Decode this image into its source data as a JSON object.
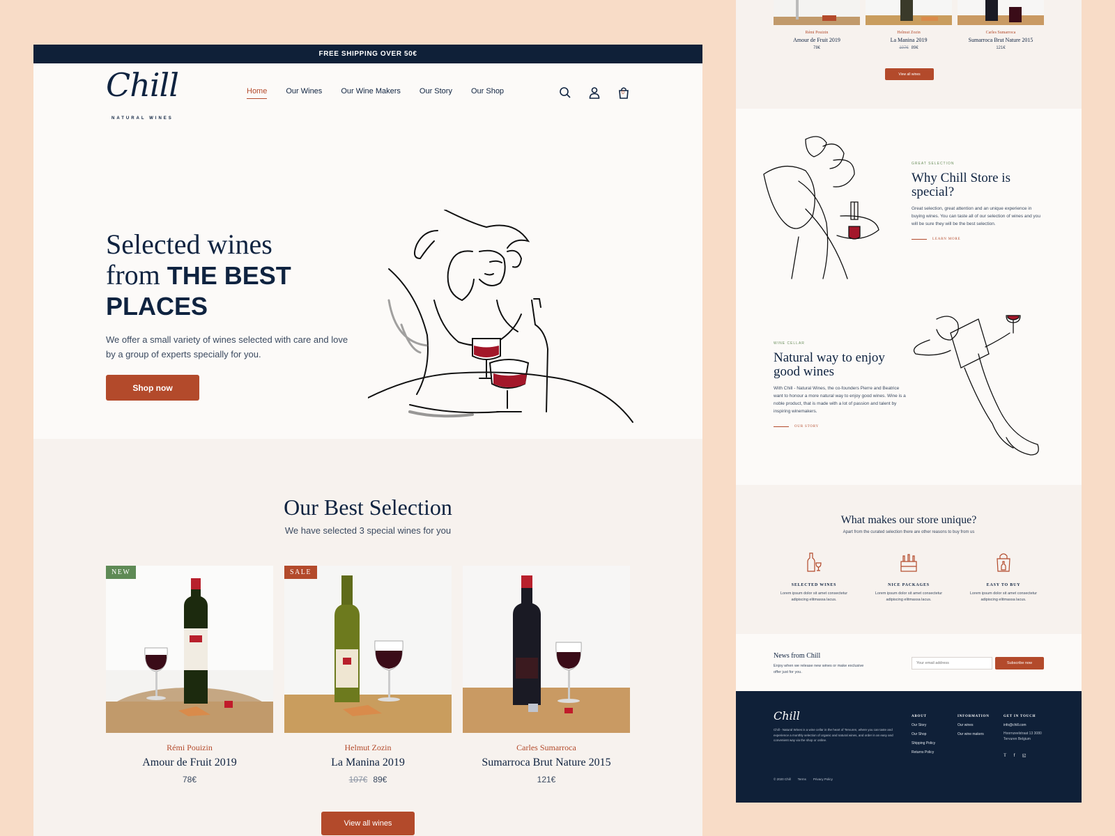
{
  "topbar": {
    "text": "FREE SHIPPING OVER 50€"
  },
  "logo": {
    "script": "Chill",
    "sub": "NATURAL WINES"
  },
  "nav": {
    "items": [
      {
        "label": "Home",
        "active": true
      },
      {
        "label": "Our Wines"
      },
      {
        "label": "Our Wine Makers"
      },
      {
        "label": "Our Story"
      },
      {
        "label": "Our Shop"
      }
    ],
    "icons": [
      "search-icon",
      "user-icon",
      "cart-icon"
    ],
    "cart_count": "0"
  },
  "hero": {
    "title_line1": "Selected wines",
    "title_line2_light": "from",
    "title_line2_bold": "THE BEST",
    "title_line3_bold": "PLACES",
    "description": "We offer a small variety of wines selected with care and love by a group of experts specially for you.",
    "button": "Shop now"
  },
  "selection": {
    "title": "Our Best Selection",
    "subtitle": "We have selected 3 special wines for you",
    "products": [
      {
        "badge": "NEW",
        "badge_color": "#5e8a55",
        "maker": "Rémi Pouizin",
        "name": "Amour de Fruit 2019",
        "price": "78€",
        "old_price": "",
        "bottle": "#1c2a0e",
        "label": "#b8202c"
      },
      {
        "badge": "SALE",
        "badge_color": "#b34a2b",
        "maker": "Helmut Zozin",
        "name": "La Manina 2019",
        "price": "89€",
        "old_price": "107€",
        "bottle": "#5f6b1a",
        "label": "#efe6d2"
      },
      {
        "badge": "",
        "badge_color": "",
        "maker": "Carles Sumarroca",
        "name": "Sumarroca Brut Nature 2015",
        "price": "121€",
        "old_price": "",
        "bottle": "#1a1a24",
        "label": "#b8202c"
      }
    ],
    "view_all": "View all wines"
  },
  "side": {
    "mini_products": [
      {
        "maker": "Rémi Pouizin",
        "name": "Amour de Fruit 2019",
        "price": "78€",
        "old_price": ""
      },
      {
        "maker": "Helmut Zozin",
        "name": "La Manina 2019",
        "price": "89€",
        "old_price": "107€"
      },
      {
        "maker": "Carles Sumarroca",
        "name": "Sumarroca Brut Nature 2015",
        "price": "121€",
        "old_price": ""
      }
    ],
    "mini_view_all": "View all wines",
    "why": {
      "eyebrow": "GREAT SELECTION",
      "title": "Why Chill Store is special?",
      "text": "Great selection, great attention and an unique experience in buying wines. You can taste all of our selection of wines and you will be sure they will be the best selection.",
      "link": "LEARN MORE"
    },
    "natural": {
      "eyebrow": "WINE CELLAR",
      "title": "Natural way to enjoy good wines",
      "text": "With Chill - Natural Wines, the co-founders Pierre and Beatrice want to honour a more natural way to enjoy good wines. Wine is a noble product, that is made with a lot of passion and talent by inspiring winemakers.",
      "link": "OUR STORY"
    },
    "unique": {
      "title": "What makes our store unique?",
      "subtitle": "Apart from the curated selection there are other reasons to buy from us",
      "features": [
        {
          "icon": "wine-bottle-icon",
          "title": "SELECTED WINES",
          "text": "Lorem ipsum dolor sit amet consectetur adipiscing elitmassa lacus."
        },
        {
          "icon": "wine-crate-icon",
          "title": "NICE PACKAGES",
          "text": "Lorem ipsum dolor sit amet consectetur adipiscing elitmassa lacus."
        },
        {
          "icon": "wine-bag-icon",
          "title": "EASY TO BUY",
          "text": "Lorem ipsum dolor sit amet consectetur adipiscing elitmassa lacus."
        }
      ]
    },
    "news": {
      "title": "News from Chill",
      "text": "Enjoy when we release new wines or make exclusive offer just for you.",
      "placeholder": "Your email address",
      "button": "Subscribe now"
    },
    "footer": {
      "logo": "Chill",
      "about": "Chill - Natural Wines is a wine cellar in the heart of Tervuren, where you can taste and experience a monthly selection of organic and natural wines, and order in an easy and convenient way via the shop or online.",
      "col1": {
        "heading": "ABOUT",
        "links": [
          "Our Story",
          "Our Shop",
          "Shipping Policy",
          "Returns Policy"
        ]
      },
      "col2": {
        "heading": "INFORMATION",
        "links": [
          "Our wines",
          "Our wine makers"
        ]
      },
      "col3": {
        "heading": "GET IN TOUCH",
        "email": "info@chill.com",
        "address": "Hoornzeelstraat 13 3080 Tervuren Belgium"
      },
      "social": [
        "twitter-icon",
        "facebook-icon",
        "instagram-icon"
      ],
      "bottom": [
        "© 2020 Chill",
        "Terms",
        "Privacy Policy"
      ]
    }
  }
}
